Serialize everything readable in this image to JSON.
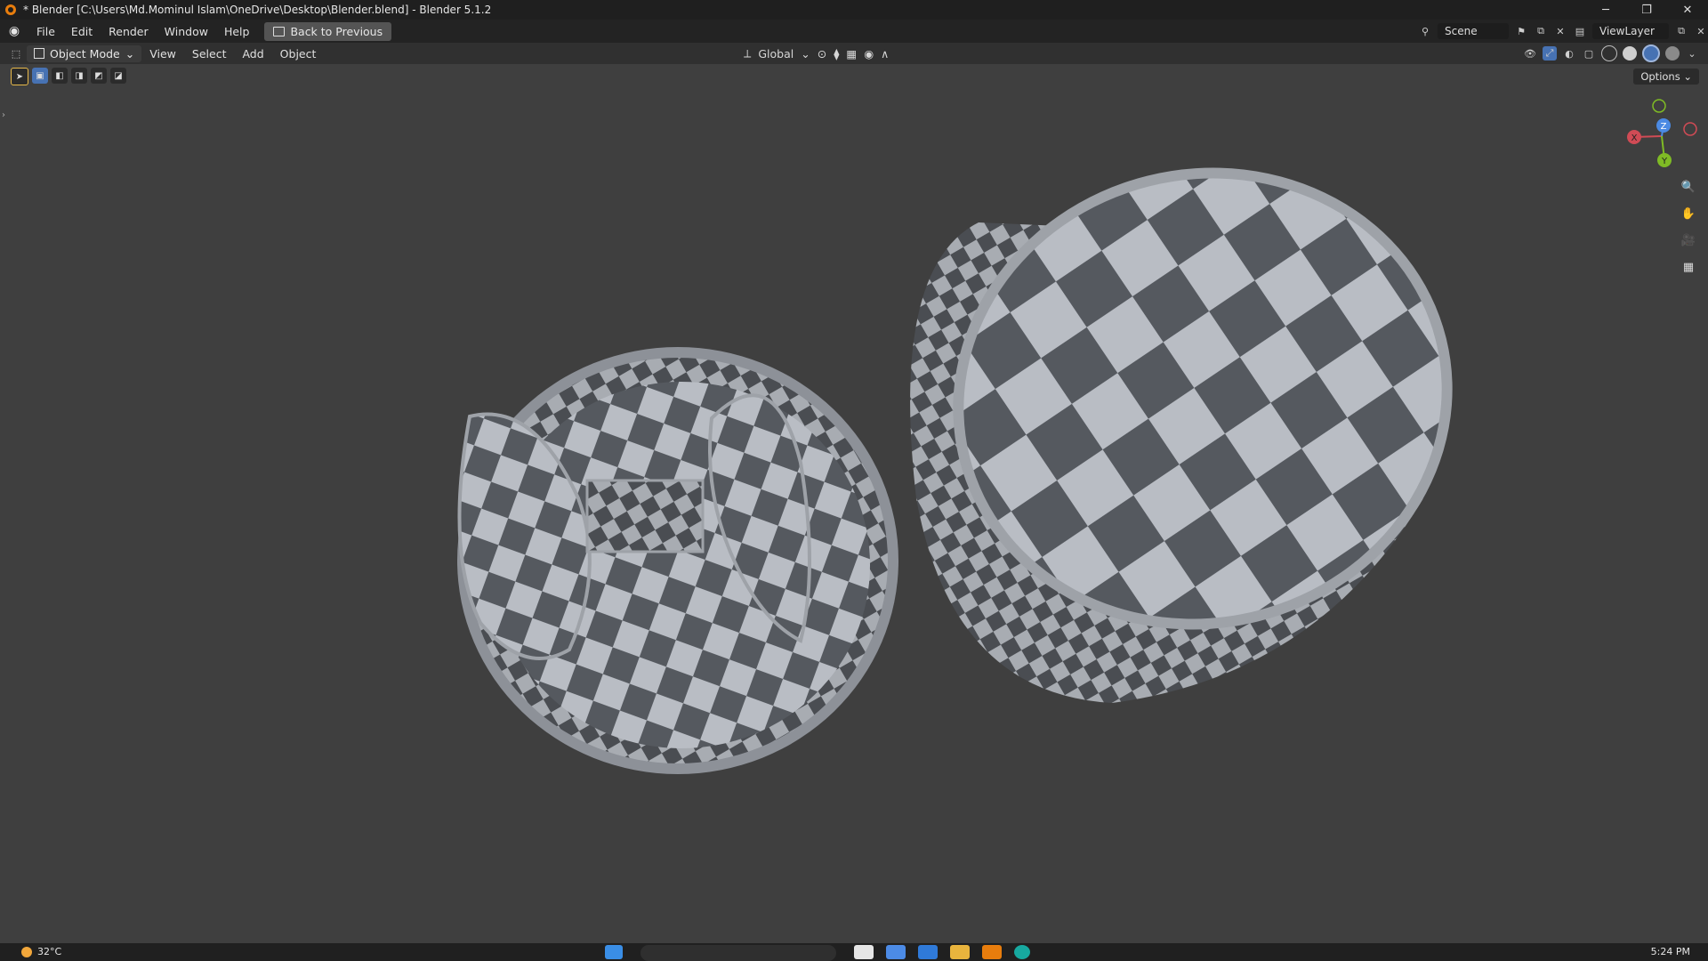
{
  "window": {
    "title": "* Blender [C:\\Users\\Md.Mominul Islam\\OneDrive\\Desktop\\Blender.blend] - Blender 5.1.2",
    "controls": [
      "─",
      "❐",
      "✕"
    ]
  },
  "menu": {
    "items": [
      "File",
      "Edit",
      "Render",
      "Window",
      "Help"
    ],
    "back_button": "Back to Previous",
    "scene": "Scene",
    "view_layer": "ViewLayer"
  },
  "viewport_header": {
    "mode": "Object Mode",
    "menus": [
      "View",
      "Select",
      "Add",
      "Object"
    ],
    "transform_orientation": "Global"
  },
  "viewport": {
    "options_label": "Options",
    "gizmo": {
      "x": "X",
      "y": "Y",
      "z": "Z"
    },
    "nav_icons": [
      "zoom-icon",
      "pan-hand-icon",
      "camera-icon",
      "grid-icon"
    ]
  },
  "taskbar": {
    "temperature": "32°C",
    "clock": "5:24 PM"
  },
  "colors": {
    "accent": "#4772b3",
    "viewport_bg": "#3f3f3f",
    "checker_light": "#b9bdc4",
    "checker_dark": "#55595f"
  }
}
